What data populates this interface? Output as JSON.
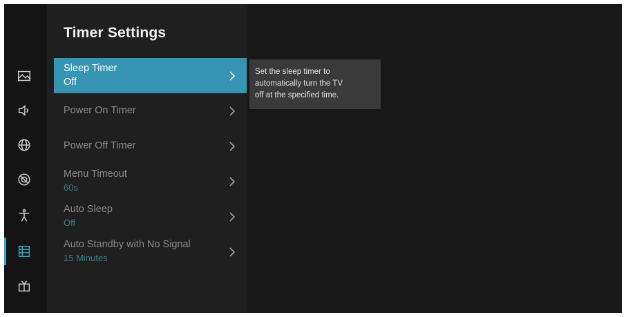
{
  "title": "Timer Settings",
  "colors": {
    "accent": "#3595b3",
    "sub_value": "#3c7b86",
    "background": "#181818",
    "panel": "#1f1f1f",
    "tooltip_bg": "#3a3a3a"
  },
  "sidebar": {
    "icons": [
      {
        "name": "picture-icon"
      },
      {
        "name": "sound-icon"
      },
      {
        "name": "network-icon"
      },
      {
        "name": "system-icon"
      },
      {
        "name": "accessibility-icon"
      },
      {
        "name": "timer-settings-icon",
        "active": true
      },
      {
        "name": "support-icon"
      }
    ]
  },
  "menu": {
    "items": [
      {
        "label": "Sleep Timer",
        "value": "Off",
        "selected": true
      },
      {
        "label": "Power On Timer",
        "value": ""
      },
      {
        "label": "Power Off Timer",
        "value": ""
      },
      {
        "label": "Menu Timeout",
        "value": "60s"
      },
      {
        "label": "Auto Sleep",
        "value": "Off"
      },
      {
        "label": "Auto Standby with No Signal",
        "value": "15 Minutes"
      }
    ]
  },
  "tooltip": {
    "text": "Set the sleep timer to\nautomatically turn the TV\noff at the specified time."
  }
}
